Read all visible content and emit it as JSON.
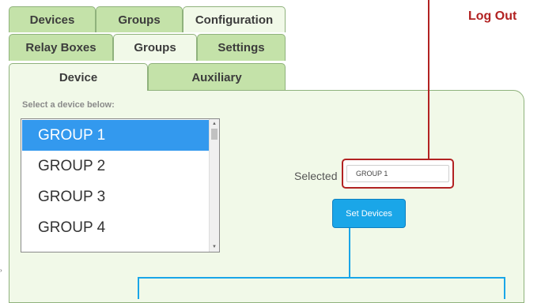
{
  "tabs_row1": [
    {
      "label": "Devices",
      "active": false
    },
    {
      "label": "Groups",
      "active": false
    },
    {
      "label": "Configuration",
      "active": true
    }
  ],
  "tabs_row2": [
    {
      "label": "Relay Boxes",
      "active": false
    },
    {
      "label": "Groups",
      "active": true
    },
    {
      "label": "Settings",
      "active": false
    }
  ],
  "tabs_row3": [
    {
      "label": "Device",
      "active": true
    },
    {
      "label": "Auxiliary",
      "active": false
    }
  ],
  "header": {
    "logout_label": "Log Out"
  },
  "device_list": {
    "prompt": "Select a device below:",
    "items": [
      "GROUP 1",
      "GROUP 2",
      "GROUP 3",
      "GROUP 4"
    ],
    "selected_index": 0
  },
  "selection": {
    "label": "Selected",
    "value": "GROUP 1"
  },
  "actions": {
    "set_devices_label": "Set Devices"
  },
  "colors": {
    "tab_inactive": "#c4e2a9",
    "tab_active": "#f1f9e8",
    "panel_bg": "#f1f9e8",
    "list_selected": "#3399ee",
    "button_bg": "#1aa6e8",
    "annotation_red": "#b22222",
    "annotation_blue": "#1aa6e8"
  }
}
